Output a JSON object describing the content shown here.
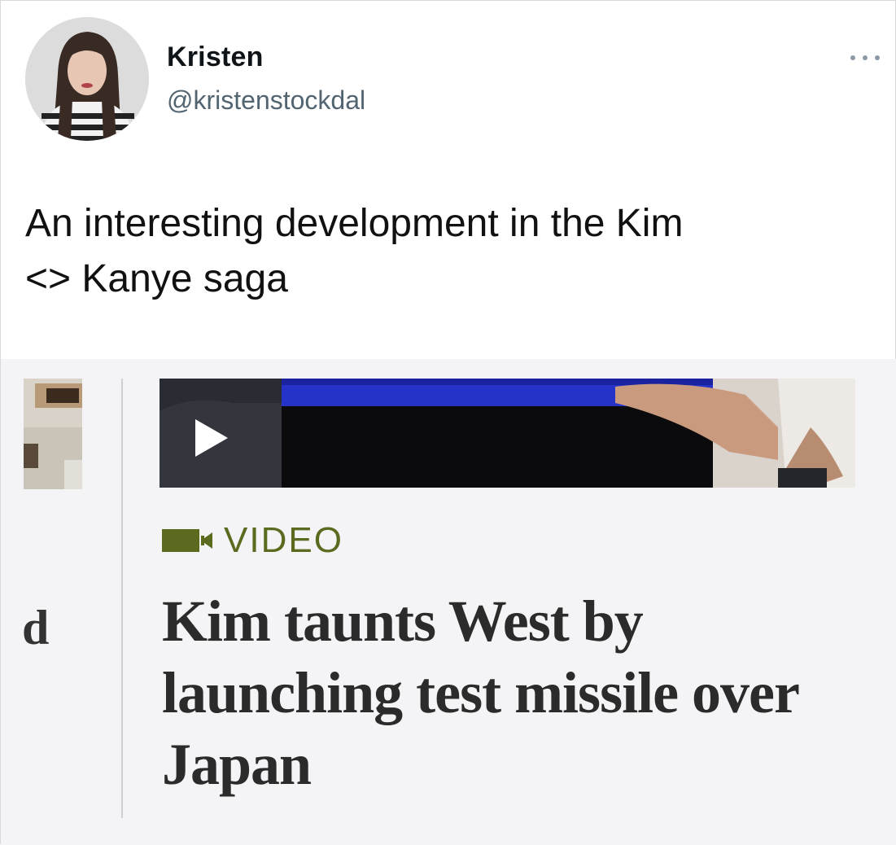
{
  "tweet": {
    "author_name": "Kristen",
    "author_handle": "@kristenstockdal",
    "text": "An interesting development in the Kim\n<> Kanye saga",
    "more_icon": "more-horizontal-icon"
  },
  "embed": {
    "left_fragment_letter": "d",
    "video_badge_icon": "video-camera-icon",
    "video_badge_label": "VIDEO",
    "headline": "Kim taunts West by launching test missile over Japan",
    "play_icon": "play-icon"
  },
  "colors": {
    "video_badge": "#5a6a1f",
    "headline": "#2b2b2b",
    "handle": "#536471"
  }
}
